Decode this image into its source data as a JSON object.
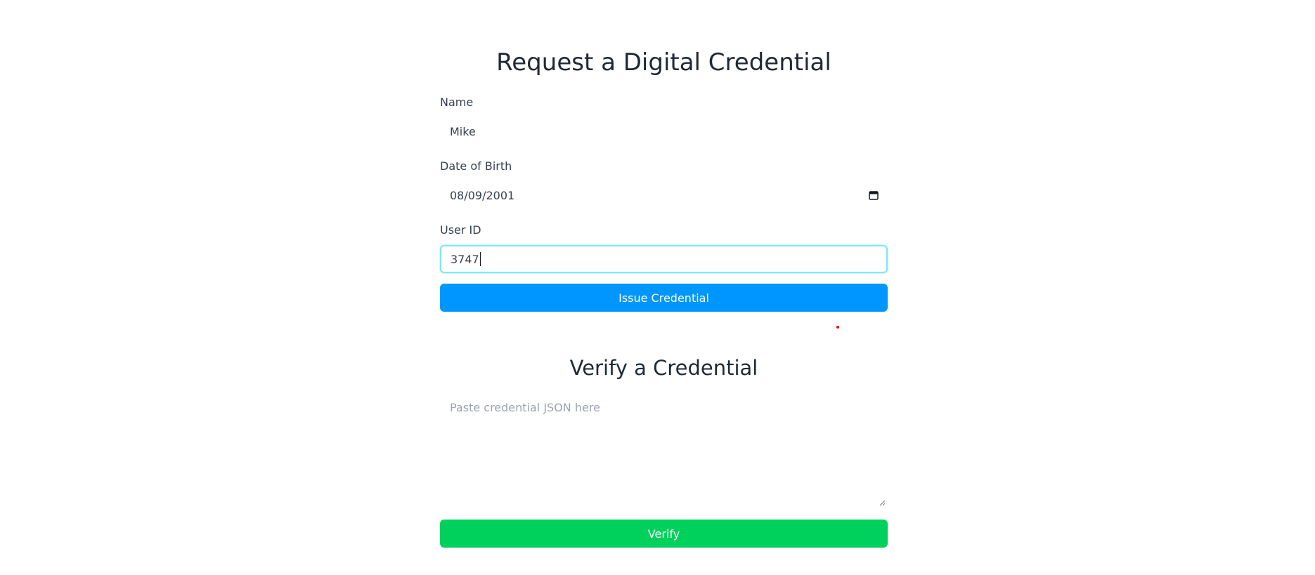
{
  "issue_form": {
    "title": "Request a Digital Credential",
    "name_label": "Name",
    "name_value": "Mike",
    "dob_label": "Date of Birth",
    "dob_value": "08/09/2001",
    "userid_label": "User ID",
    "userid_value": "3747",
    "issue_button": "Issue Credential"
  },
  "verify_form": {
    "title": "Verify a Credential",
    "json_placeholder": "Paste credential JSON here",
    "verify_button": "Verify"
  },
  "colors": {
    "issue_button": "#0096ff",
    "verify_button": "#00d15c",
    "focus_ring": "#7ee7f5"
  }
}
